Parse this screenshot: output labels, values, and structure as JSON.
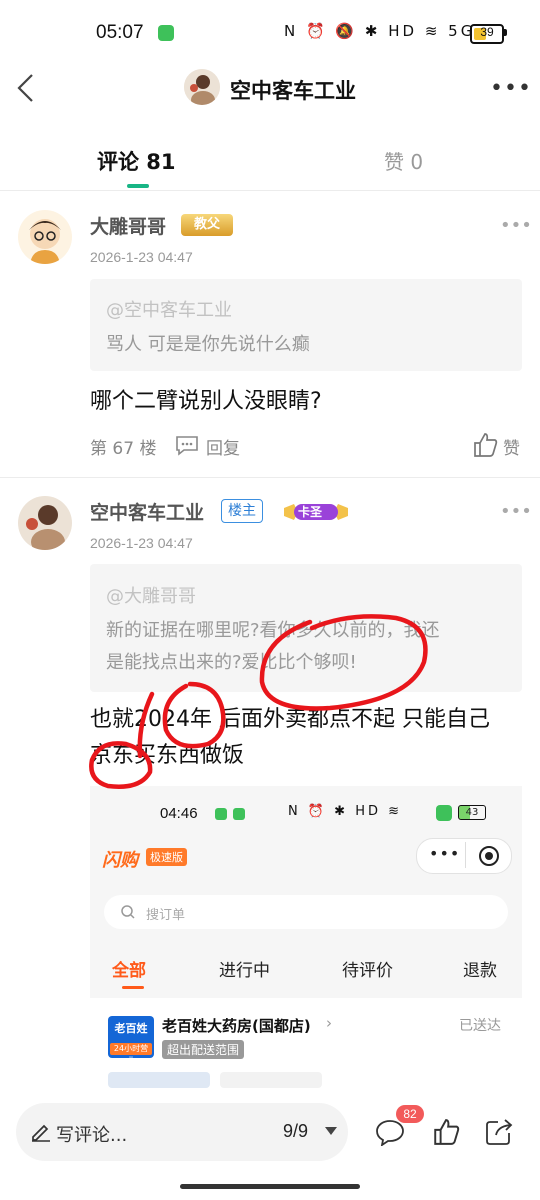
{
  "status_bar": {
    "time": "05:07",
    "battery": "39",
    "icons": "N ⏰ 🔕 ✱ HD ≋ 5G"
  },
  "nav": {
    "title": "空中客车工业"
  },
  "tabs": [
    {
      "label": "评论 81",
      "active": true
    },
    {
      "label": "赞 0",
      "active": false
    }
  ],
  "comments": [
    {
      "user": "大雕哥哥",
      "badge": "教父",
      "time": "2026-1-23 04:47",
      "quote_name": "@空中客车工业",
      "quote_text": "骂人 可是是你先说什么癫",
      "text": "哪个二臂说别人没眼睛?",
      "floor": "第 67 楼",
      "reply_label": "回复",
      "like_label": "赞"
    },
    {
      "user": "空中客车工业",
      "badge_owner": "楼主",
      "badge": "卡圣",
      "time": "2026-1-23 04:47",
      "quote_name": "@大雕哥哥",
      "quote_text_line1": "新的证据在哪里呢?看你多久以前的，我还",
      "quote_text_line2": "是能找点出来的?爱比比个够呗!",
      "text_line1": "也就2024年 后面外卖都点不起 只能自己",
      "text_line2": "京东买东西做饭"
    }
  ],
  "embedded_screenshot": {
    "time": "04:46",
    "battery": "43",
    "brand": "闪购",
    "brand_tag": "极速版",
    "search_placeholder": "搜订单",
    "tabs": [
      "全部",
      "进行中",
      "待评价",
      "退款"
    ],
    "store_name": "老百姓大药房(国都店)",
    "store_status": "已送达",
    "store_tag": "超出配送范围",
    "logo_text": "老百姓",
    "logo_sub": "24小时营业"
  },
  "bottom_bar": {
    "write_label": "写评论...",
    "page_indicator": "9/9",
    "comment_count": "82"
  },
  "colors": {
    "accent": "#18b585",
    "annotation_red": "#e8161b",
    "shot_accent": "#ff5a1a"
  }
}
